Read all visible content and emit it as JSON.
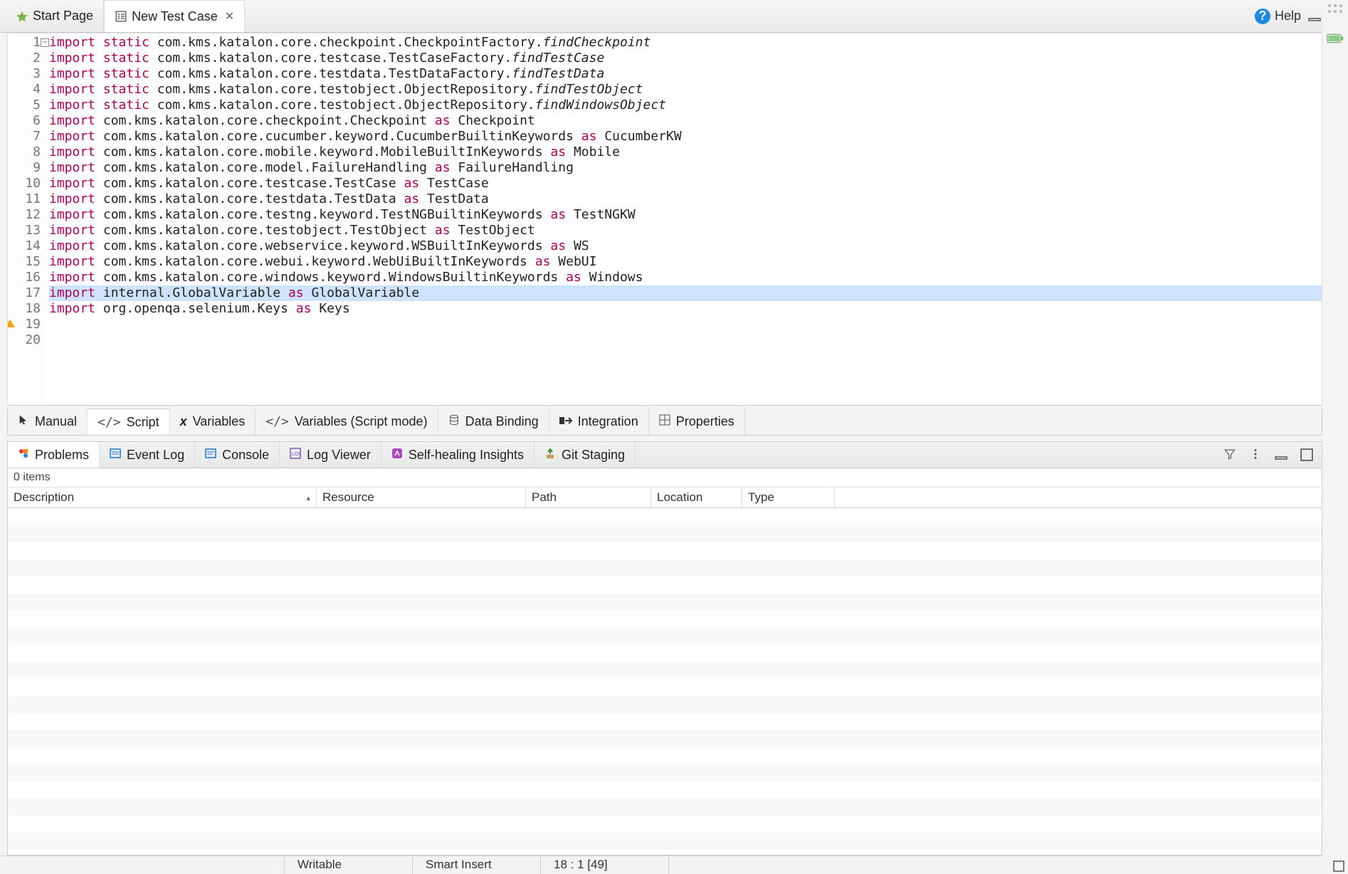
{
  "tabs": {
    "start_page": "Start Page",
    "new_test_case": "New Test Case"
  },
  "help_label": "Help",
  "code": {
    "highlighted_line": 17,
    "lines": [
      {
        "n": 1,
        "tokens": [
          {
            "t": "import",
            "c": "kw"
          },
          {
            "t": " "
          },
          {
            "t": "static",
            "c": "kw"
          },
          {
            "t": " com.kms.katalon.core.checkpoint.CheckpointFactory."
          },
          {
            "t": "findCheckpoint",
            "c": "fn-it"
          }
        ]
      },
      {
        "n": 2,
        "tokens": [
          {
            "t": "import",
            "c": "kw"
          },
          {
            "t": " "
          },
          {
            "t": "static",
            "c": "kw"
          },
          {
            "t": " com.kms.katalon.core.testcase.TestCaseFactory."
          },
          {
            "t": "findTestCase",
            "c": "fn-it"
          }
        ]
      },
      {
        "n": 3,
        "tokens": [
          {
            "t": "import",
            "c": "kw"
          },
          {
            "t": " "
          },
          {
            "t": "static",
            "c": "kw"
          },
          {
            "t": " com.kms.katalon.core.testdata.TestDataFactory."
          },
          {
            "t": "findTestData",
            "c": "fn-it"
          }
        ]
      },
      {
        "n": 4,
        "tokens": [
          {
            "t": "import",
            "c": "kw"
          },
          {
            "t": " "
          },
          {
            "t": "static",
            "c": "kw"
          },
          {
            "t": " com.kms.katalon.core.testobject.ObjectRepository."
          },
          {
            "t": "findTestObject",
            "c": "fn-it"
          }
        ]
      },
      {
        "n": 5,
        "tokens": [
          {
            "t": "import",
            "c": "kw"
          },
          {
            "t": " "
          },
          {
            "t": "static",
            "c": "kw"
          },
          {
            "t": " com.kms.katalon.core.testobject.ObjectRepository."
          },
          {
            "t": "findWindowsObject",
            "c": "fn-it"
          }
        ]
      },
      {
        "n": 6,
        "tokens": [
          {
            "t": "import",
            "c": "kw"
          },
          {
            "t": " com.kms.katalon.core.checkpoint.Checkpoint "
          },
          {
            "t": "as",
            "c": "kw"
          },
          {
            "t": " Checkpoint"
          }
        ]
      },
      {
        "n": 7,
        "tokens": [
          {
            "t": "import",
            "c": "kw"
          },
          {
            "t": " com.kms.katalon.core.cucumber.keyword.CucumberBuiltinKeywords "
          },
          {
            "t": "as",
            "c": "kw"
          },
          {
            "t": " CucumberKW"
          }
        ]
      },
      {
        "n": 8,
        "tokens": [
          {
            "t": "import",
            "c": "kw"
          },
          {
            "t": " com.kms.katalon.core.mobile.keyword.MobileBuiltInKeywords "
          },
          {
            "t": "as",
            "c": "kw"
          },
          {
            "t": " Mobile"
          }
        ]
      },
      {
        "n": 9,
        "tokens": [
          {
            "t": "import",
            "c": "kw"
          },
          {
            "t": " com.kms.katalon.core.model.FailureHandling "
          },
          {
            "t": "as",
            "c": "kw"
          },
          {
            "t": " FailureHandling"
          }
        ]
      },
      {
        "n": 10,
        "tokens": [
          {
            "t": "import",
            "c": "kw"
          },
          {
            "t": " com.kms.katalon.core.testcase.TestCase "
          },
          {
            "t": "as",
            "c": "kw"
          },
          {
            "t": " TestCase"
          }
        ]
      },
      {
        "n": 11,
        "tokens": [
          {
            "t": "import",
            "c": "kw"
          },
          {
            "t": " com.kms.katalon.core.testdata.TestData "
          },
          {
            "t": "as",
            "c": "kw"
          },
          {
            "t": " TestData"
          }
        ]
      },
      {
        "n": 12,
        "tokens": [
          {
            "t": "import",
            "c": "kw"
          },
          {
            "t": " com.kms.katalon.core.testng.keyword.TestNGBuiltinKeywords "
          },
          {
            "t": "as",
            "c": "kw"
          },
          {
            "t": " TestNGKW"
          }
        ]
      },
      {
        "n": 13,
        "tokens": [
          {
            "t": "import",
            "c": "kw"
          },
          {
            "t": " com.kms.katalon.core.testobject.TestObject "
          },
          {
            "t": "as",
            "c": "kw"
          },
          {
            "t": " TestObject"
          }
        ]
      },
      {
        "n": 14,
        "tokens": [
          {
            "t": "import",
            "c": "kw"
          },
          {
            "t": " com.kms.katalon.core.webservice.keyword.WSBuiltInKeywords "
          },
          {
            "t": "as",
            "c": "kw"
          },
          {
            "t": " WS"
          }
        ]
      },
      {
        "n": 15,
        "tokens": [
          {
            "t": "import",
            "c": "kw"
          },
          {
            "t": " com.kms.katalon.core.webui.keyword.WebUiBuiltInKeywords "
          },
          {
            "t": "as",
            "c": "kw"
          },
          {
            "t": " WebUI"
          }
        ]
      },
      {
        "n": 16,
        "tokens": [
          {
            "t": "import",
            "c": "kw"
          },
          {
            "t": " com.kms.katalon.core.windows.keyword.WindowsBuiltinKeywords "
          },
          {
            "t": "as",
            "c": "kw"
          },
          {
            "t": " Windows"
          }
        ]
      },
      {
        "n": 17,
        "tokens": [
          {
            "t": "import",
            "c": "kw"
          },
          {
            "t": " internal.GlobalVariable "
          },
          {
            "t": "as",
            "c": "kw"
          },
          {
            "t": " GlobalVariable"
          }
        ]
      },
      {
        "n": 18,
        "tokens": [
          {
            "t": "import",
            "c": "kw"
          },
          {
            "t": " org.openqa.selenium.Keys "
          },
          {
            "t": "as",
            "c": "kw"
          },
          {
            "t": " Keys"
          }
        ]
      },
      {
        "n": 19,
        "tokens": []
      },
      {
        "n": 20,
        "tokens": []
      }
    ]
  },
  "mode_tabs": {
    "manual": "Manual",
    "script": "Script",
    "variables": "Variables",
    "variables_script": "Variables (Script mode)",
    "data_binding": "Data Binding",
    "integration": "Integration",
    "properties": "Properties"
  },
  "panel_tabs": {
    "problems": "Problems",
    "event_log": "Event Log",
    "console": "Console",
    "log_viewer": "Log Viewer",
    "self_healing": "Self-healing Insights",
    "git_staging": "Git Staging"
  },
  "panel": {
    "items_count": "0 items",
    "columns": {
      "description": "Description",
      "resource": "Resource",
      "path": "Path",
      "location": "Location",
      "type": "Type"
    }
  },
  "status": {
    "writable": "Writable",
    "insert_mode": "Smart Insert",
    "cursor": "18 : 1 [49]"
  }
}
